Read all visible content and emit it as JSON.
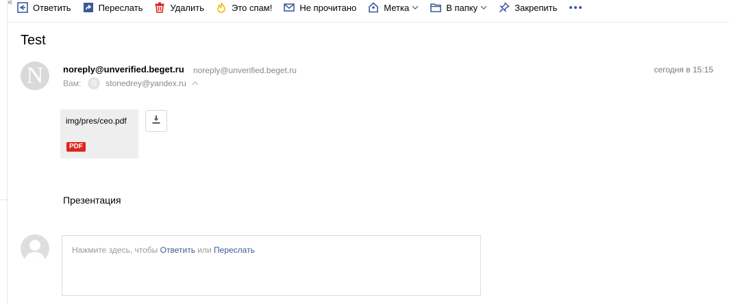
{
  "toolbar": {
    "reply": "Ответить",
    "forward": "Переслать",
    "delete": "Удалить",
    "spam": "Это спам!",
    "unread": "Не прочитано",
    "label": "Метка",
    "folder": "В папку",
    "pin": "Закрепить"
  },
  "gutter": {
    "collapse_glyph": "«"
  },
  "message": {
    "subject": "Test",
    "avatar_letter": "N",
    "sender_name": "noreply@unverified.beget.ru",
    "sender_email": "noreply@unverified.beget.ru",
    "date": "сегодня в 15:15",
    "to_label": "Вам:",
    "to_avatar_letter": "S",
    "to_email": "stonedrey@yandex.ru",
    "attachment": {
      "name": "img/pres/ceo.pdf",
      "type_badge": "PDF"
    },
    "body": "Презентация"
  },
  "reply": {
    "hint_prefix": "Нажмите здесь, чтобы ",
    "reply_link": "Ответить",
    "hint_or": " или ",
    "forward_link": "Переслать"
  },
  "colors": {
    "accent": "#3b5998",
    "delete_red": "#d9221a",
    "spam_yellow": "#f5b800",
    "pdf_badge": "#e0241b"
  }
}
